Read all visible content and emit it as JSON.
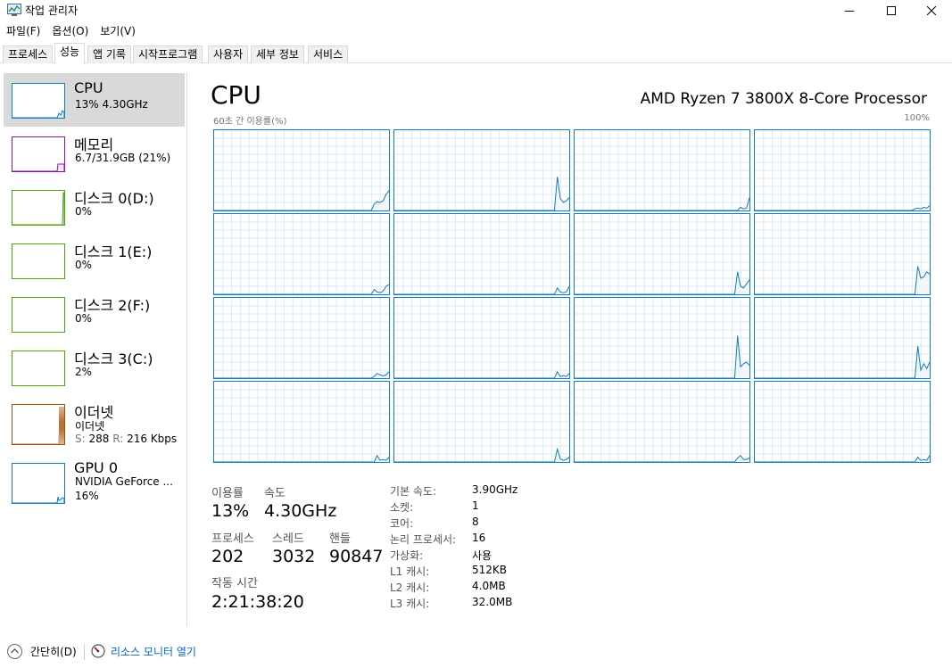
{
  "window": {
    "title": "작업 관리자",
    "controls": [
      "minimize-icon",
      "maximize-icon",
      "close-icon"
    ]
  },
  "menu": [
    "파일(F)",
    "옵션(O)",
    "보기(V)"
  ],
  "tabs": [
    "프로세스",
    "성능",
    "앱 기록",
    "시작프로그램",
    "사용자",
    "세부 정보",
    "서비스"
  ],
  "active_tab": "성능",
  "sidebar": {
    "items": [
      {
        "title": "CPU",
        "line1": "13% 4.30GHz",
        "color": "#117dbb",
        "selected": true
      },
      {
        "title": "메모리",
        "line1": "6.7/31.9GB (21%)",
        "color": "#8b12ae"
      },
      {
        "title": "디스크 0(D:)",
        "line1": "0%",
        "color": "#4da60c"
      },
      {
        "title": "디스크 1(E:)",
        "line1": "0%",
        "color": "#4da60c"
      },
      {
        "title": "디스크 2(F:)",
        "line1": "0%",
        "color": "#4da60c"
      },
      {
        "title": "디스크 3(C:)",
        "line1": "2%",
        "color": "#4da60c"
      },
      {
        "title": "이더넷",
        "line1": "이더넷",
        "line2_s_label": "S:",
        "line2_s_value": "288",
        "line2_r_label": "R:",
        "line2_r_value": "216 Kbps",
        "color": "#a74f01"
      },
      {
        "title": "GPU 0",
        "line1": "NVIDIA GeForce ...",
        "line2": "16%",
        "color": "#117dbb"
      }
    ]
  },
  "main": {
    "title": "CPU",
    "processor": "AMD Ryzen 7 3800X 8-Core Processor",
    "axis_label": "60초 간 이용률(%)",
    "axis_max": "100%",
    "graph_color": "#117dbb"
  },
  "stats": {
    "usage_label": "이용률",
    "usage_value": "13%",
    "speed_label": "속도",
    "speed_value": "4.30GHz",
    "processes_label": "프로세스",
    "processes_value": "202",
    "threads_label": "스레드",
    "threads_value": "3032",
    "handles_label": "핸들",
    "handles_value": "90847",
    "uptime_label": "작동 시간",
    "uptime_value": "2:21:38:20"
  },
  "details": [
    {
      "key": "기본 속도:",
      "value": "3.90GHz"
    },
    {
      "key": "소켓:",
      "value": "1"
    },
    {
      "key": "코어:",
      "value": "8"
    },
    {
      "key": "논리 프로세서:",
      "value": "16"
    },
    {
      "key": "가상화:",
      "value": "사용"
    },
    {
      "key": "L1 캐시:",
      "value": "512KB"
    },
    {
      "key": "L2 캐시:",
      "value": "4.0MB"
    },
    {
      "key": "L3 캐시:",
      "value": "32.0MB"
    }
  ],
  "footer": {
    "fewer_details": "간단히(D)",
    "resource_monitor": "리소스 모니터 열기"
  },
  "core_usage": [
    [
      0,
      0,
      0,
      0,
      0,
      0,
      0,
      0,
      0,
      0,
      0,
      0,
      0,
      0,
      0,
      0,
      0,
      0,
      0,
      0,
      0,
      0,
      0,
      0,
      0,
      0,
      0,
      0,
      0,
      0,
      0,
      0,
      0,
      0,
      0,
      0,
      0,
      0,
      0,
      0,
      0,
      0,
      0,
      0,
      0,
      0,
      0,
      0,
      0,
      0,
      0,
      0,
      0,
      0,
      8,
      11,
      10,
      12,
      20,
      25
    ],
    [
      0,
      0,
      0,
      0,
      0,
      0,
      0,
      0,
      0,
      0,
      0,
      0,
      0,
      0,
      0,
      0,
      0,
      0,
      0,
      0,
      0,
      0,
      0,
      0,
      0,
      0,
      0,
      0,
      0,
      0,
      0,
      0,
      0,
      0,
      0,
      0,
      0,
      0,
      0,
      0,
      0,
      0,
      0,
      0,
      0,
      0,
      0,
      0,
      0,
      0,
      0,
      0,
      0,
      0,
      0,
      42,
      15,
      10,
      12,
      16
    ],
    [
      0,
      0,
      0,
      0,
      0,
      0,
      0,
      0,
      0,
      0,
      0,
      0,
      0,
      0,
      0,
      0,
      0,
      0,
      0,
      0,
      0,
      0,
      0,
      0,
      0,
      0,
      0,
      0,
      0,
      0,
      0,
      0,
      0,
      0,
      0,
      0,
      0,
      0,
      0,
      0,
      0,
      0,
      0,
      0,
      0,
      0,
      0,
      0,
      0,
      0,
      0,
      0,
      0,
      0,
      0,
      0,
      4,
      2,
      3,
      16
    ],
    [
      0,
      0,
      0,
      0,
      0,
      0,
      0,
      0,
      0,
      0,
      0,
      0,
      0,
      0,
      0,
      0,
      0,
      0,
      0,
      0,
      0,
      0,
      0,
      0,
      0,
      0,
      0,
      0,
      0,
      0,
      0,
      0,
      0,
      0,
      0,
      0,
      0,
      0,
      0,
      0,
      0,
      0,
      0,
      0,
      0,
      0,
      0,
      0,
      0,
      0,
      0,
      0,
      0,
      0,
      2,
      3,
      2,
      4,
      3,
      6
    ],
    [
      0,
      0,
      0,
      0,
      0,
      0,
      0,
      0,
      0,
      0,
      0,
      0,
      0,
      0,
      0,
      0,
      0,
      0,
      0,
      0,
      0,
      0,
      0,
      0,
      0,
      0,
      0,
      0,
      0,
      0,
      0,
      0,
      0,
      0,
      0,
      0,
      0,
      0,
      0,
      0,
      0,
      0,
      0,
      0,
      0,
      0,
      0,
      0,
      0,
      0,
      0,
      0,
      0,
      0,
      6,
      3,
      2,
      4,
      10,
      12
    ],
    [
      0,
      0,
      0,
      0,
      0,
      0,
      0,
      0,
      0,
      0,
      0,
      0,
      0,
      0,
      0,
      0,
      0,
      0,
      0,
      0,
      0,
      0,
      0,
      0,
      0,
      0,
      0,
      0,
      0,
      0,
      0,
      0,
      0,
      0,
      0,
      0,
      0,
      0,
      0,
      0,
      0,
      0,
      0,
      0,
      0,
      0,
      0,
      0,
      0,
      0,
      0,
      0,
      0,
      0,
      0,
      8,
      3,
      2,
      3,
      10
    ],
    [
      0,
      0,
      0,
      0,
      0,
      0,
      0,
      0,
      0,
      0,
      0,
      0,
      0,
      0,
      0,
      0,
      0,
      0,
      0,
      0,
      0,
      0,
      0,
      0,
      0,
      0,
      0,
      0,
      0,
      0,
      0,
      0,
      0,
      0,
      0,
      0,
      0,
      0,
      0,
      0,
      0,
      0,
      0,
      0,
      0,
      0,
      0,
      0,
      0,
      0,
      0,
      0,
      0,
      0,
      0,
      28,
      10,
      8,
      13,
      18
    ],
    [
      0,
      0,
      0,
      0,
      0,
      0,
      0,
      0,
      0,
      0,
      0,
      0,
      0,
      0,
      0,
      0,
      0,
      0,
      0,
      0,
      0,
      0,
      0,
      0,
      0,
      0,
      0,
      0,
      0,
      0,
      0,
      0,
      0,
      0,
      0,
      0,
      0,
      0,
      0,
      0,
      0,
      0,
      0,
      0,
      0,
      0,
      0,
      0,
      0,
      0,
      0,
      0,
      0,
      0,
      0,
      35,
      20,
      22,
      28,
      25
    ],
    [
      0,
      0,
      0,
      0,
      0,
      0,
      0,
      0,
      0,
      0,
      0,
      0,
      0,
      0,
      0,
      0,
      0,
      0,
      0,
      0,
      0,
      0,
      0,
      0,
      0,
      0,
      0,
      0,
      0,
      0,
      0,
      0,
      0,
      0,
      0,
      0,
      0,
      0,
      0,
      0,
      0,
      0,
      0,
      0,
      0,
      0,
      0,
      0,
      0,
      0,
      0,
      0,
      0,
      0,
      2,
      6,
      4,
      3,
      4,
      8
    ],
    [
      0,
      0,
      0,
      0,
      0,
      0,
      0,
      0,
      0,
      0,
      0,
      0,
      0,
      0,
      0,
      0,
      0,
      0,
      0,
      0,
      0,
      0,
      0,
      0,
      0,
      0,
      0,
      0,
      0,
      0,
      0,
      0,
      0,
      0,
      0,
      0,
      0,
      0,
      0,
      0,
      0,
      0,
      0,
      0,
      0,
      0,
      0,
      0,
      0,
      0,
      0,
      0,
      0,
      0,
      0,
      8,
      2,
      3,
      2,
      6
    ],
    [
      0,
      0,
      0,
      0,
      0,
      0,
      0,
      0,
      0,
      0,
      0,
      0,
      0,
      0,
      0,
      0,
      0,
      0,
      0,
      0,
      0,
      0,
      0,
      0,
      0,
      0,
      0,
      0,
      0,
      0,
      0,
      0,
      0,
      0,
      0,
      0,
      0,
      0,
      0,
      0,
      0,
      0,
      0,
      0,
      0,
      0,
      0,
      0,
      0,
      0,
      0,
      0,
      0,
      0,
      0,
      53,
      14,
      18,
      20,
      16
    ],
    [
      0,
      0,
      0,
      0,
      0,
      0,
      0,
      0,
      0,
      0,
      0,
      0,
      0,
      0,
      0,
      0,
      0,
      0,
      0,
      0,
      0,
      0,
      0,
      0,
      0,
      0,
      0,
      0,
      0,
      0,
      0,
      0,
      0,
      0,
      0,
      0,
      0,
      0,
      0,
      0,
      0,
      0,
      0,
      0,
      0,
      0,
      0,
      0,
      0,
      0,
      0,
      0,
      0,
      0,
      0,
      40,
      10,
      18,
      12,
      20
    ],
    [
      0,
      0,
      0,
      0,
      0,
      0,
      0,
      0,
      0,
      0,
      0,
      0,
      0,
      0,
      0,
      0,
      0,
      0,
      0,
      0,
      0,
      0,
      0,
      0,
      0,
      0,
      0,
      0,
      0,
      0,
      0,
      0,
      0,
      0,
      0,
      0,
      0,
      0,
      0,
      0,
      0,
      0,
      0,
      0,
      0,
      0,
      0,
      0,
      0,
      0,
      0,
      0,
      0,
      0,
      0,
      8,
      2,
      3,
      2,
      6
    ],
    [
      0,
      0,
      0,
      0,
      0,
      0,
      0,
      0,
      0,
      0,
      0,
      0,
      0,
      0,
      0,
      0,
      0,
      0,
      0,
      0,
      0,
      0,
      0,
      0,
      0,
      0,
      0,
      0,
      0,
      0,
      0,
      0,
      0,
      0,
      0,
      0,
      0,
      0,
      0,
      0,
      0,
      0,
      0,
      0,
      0,
      0,
      0,
      0,
      0,
      0,
      0,
      0,
      0,
      0,
      0,
      16,
      4,
      2,
      3,
      6
    ],
    [
      0,
      0,
      0,
      0,
      0,
      0,
      0,
      0,
      0,
      0,
      0,
      0,
      0,
      0,
      0,
      0,
      0,
      0,
      0,
      0,
      0,
      0,
      0,
      0,
      0,
      0,
      0,
      0,
      0,
      0,
      0,
      0,
      0,
      0,
      0,
      0,
      0,
      0,
      0,
      0,
      0,
      0,
      0,
      0,
      0,
      0,
      0,
      0,
      0,
      0,
      0,
      0,
      0,
      0,
      0,
      5,
      8,
      3,
      3,
      5
    ],
    [
      0,
      0,
      0,
      0,
      0,
      0,
      0,
      0,
      0,
      0,
      0,
      0,
      0,
      0,
      0,
      0,
      0,
      0,
      0,
      0,
      0,
      0,
      0,
      0,
      0,
      0,
      0,
      0,
      0,
      0,
      0,
      0,
      0,
      0,
      0,
      0,
      0,
      0,
      0,
      0,
      0,
      0,
      0,
      0,
      0,
      0,
      0,
      0,
      0,
      0,
      0,
      0,
      0,
      0,
      0,
      6,
      2,
      3,
      2,
      8
    ]
  ]
}
